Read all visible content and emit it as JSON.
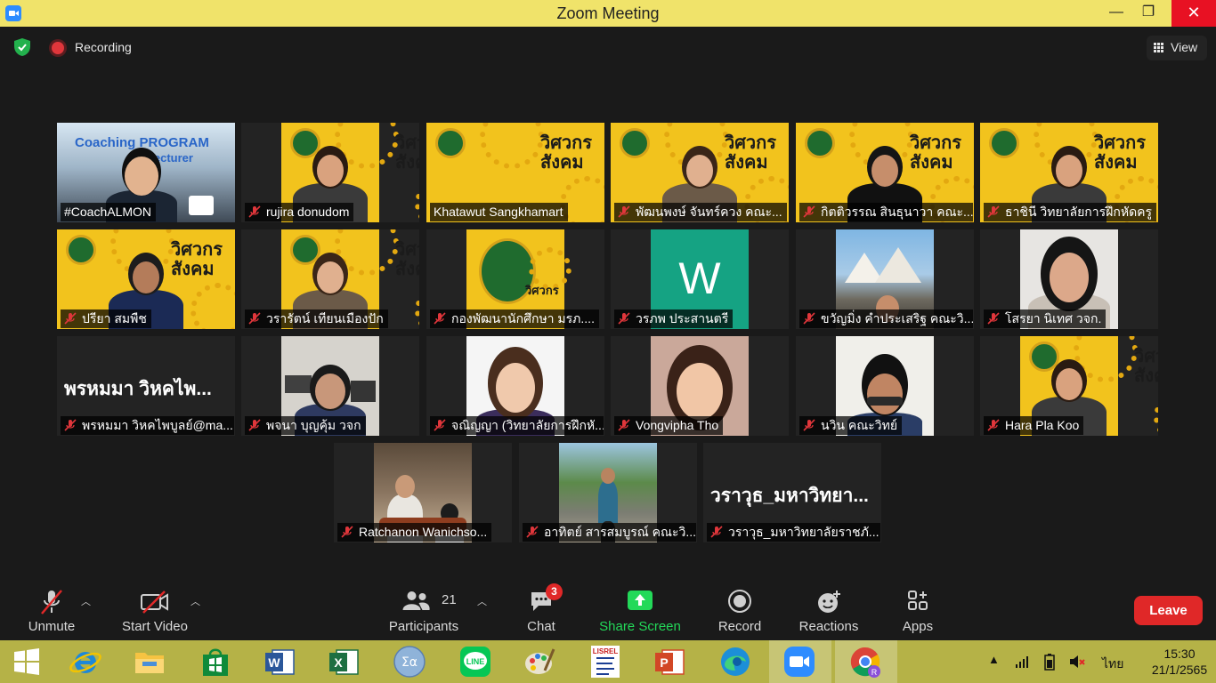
{
  "window": {
    "title": "Zoom Meeting",
    "minimize": "—",
    "maximize": "❐",
    "close": "✕"
  },
  "topbar": {
    "recording_label": "Recording",
    "view_label": "View"
  },
  "participants": [
    {
      "name": "#CoachALMON",
      "muted": false,
      "active": true,
      "kind": "coach",
      "banner_line1": "Coaching PROGRAM",
      "banner_line2": "for Lecturer"
    },
    {
      "name": "rujira donudom",
      "muted": true,
      "kind": "poster-person"
    },
    {
      "name": "Khatawut Sangkhamart",
      "muted": false,
      "kind": "poster"
    },
    {
      "name": "พัฒนพงษ์ จันทร์ควง คณะ...",
      "muted": true,
      "kind": "poster-person"
    },
    {
      "name": "กิตติวรรณ สินธุนาวา คณะ...",
      "muted": true,
      "kind": "poster-person"
    },
    {
      "name": "ธาชินี วิทยาลัยการฝึกหัดครู",
      "muted": true,
      "kind": "poster-person"
    },
    {
      "name": "ปรียา สมพืช",
      "muted": true,
      "kind": "poster-person"
    },
    {
      "name": "วรารัตน์ เทียนเมืองปัก",
      "muted": true,
      "kind": "poster-person"
    },
    {
      "name": "กองพัฒนานักศึกษา มรภ....",
      "muted": true,
      "kind": "poster-logo"
    },
    {
      "name": "วรภพ ประสานตรี",
      "muted": true,
      "kind": "w-avatar",
      "avatar_letter": "W"
    },
    {
      "name": "ขวัญมิ่ง คำประเสริฐ คณะวิ...",
      "muted": true,
      "kind": "photo-opera"
    },
    {
      "name": "โสรยา นิเทศ วจก.",
      "muted": true,
      "kind": "photo-woman"
    },
    {
      "name": "พรหมมา วิหคไพบูลย์@ma...",
      "muted": true,
      "kind": "text",
      "big_name": "พรหมมา วิหคไพ..."
    },
    {
      "name": "พจนา บุญคุ้ม วจก",
      "muted": true,
      "kind": "photo-office"
    },
    {
      "name": "จณิญญา (วิทยาลัยการฝึกหั...",
      "muted": true,
      "kind": "photo-woman2"
    },
    {
      "name": "Vongvipha Tho",
      "muted": true,
      "kind": "photo-woman3"
    },
    {
      "name": "นวิน คณะวิทย์",
      "muted": true,
      "kind": "photo-man"
    },
    {
      "name": "Hara Pla Koo",
      "muted": true,
      "kind": "poster-person"
    },
    {
      "name": "Ratchanon Wanichso...",
      "muted": true,
      "kind": "photo-restaurant"
    },
    {
      "name": "อาทิตย์ สารสมบูรณ์ คณะวิ...",
      "muted": true,
      "kind": "photo-street"
    },
    {
      "name": "วราวุธ_มหาวิทยาลัยราชภั...",
      "muted": true,
      "kind": "text",
      "big_name": "วราวุธ_มหาวิทยา..."
    }
  ],
  "poster": {
    "line1": "วิศวกร",
    "line2": "สังคม"
  },
  "toolbar": {
    "unmute": "Unmute",
    "start_video": "Start Video",
    "participants": "Participants",
    "participants_count": "21",
    "chat": "Chat",
    "chat_badge": "3",
    "share_screen": "Share Screen",
    "record": "Record",
    "reactions": "Reactions",
    "apps": "Apps",
    "leave": "Leave"
  },
  "taskbar": {
    "language": "ไทย",
    "time": "15:30",
    "date": "21/1/2565",
    "lisrel": "LISREL"
  },
  "colors": {
    "active_border": "#e9f069",
    "leave": "#e02828",
    "share_green": "#23d959",
    "poster_yellow": "#f2c31d",
    "taskbar": "#b5b247"
  }
}
